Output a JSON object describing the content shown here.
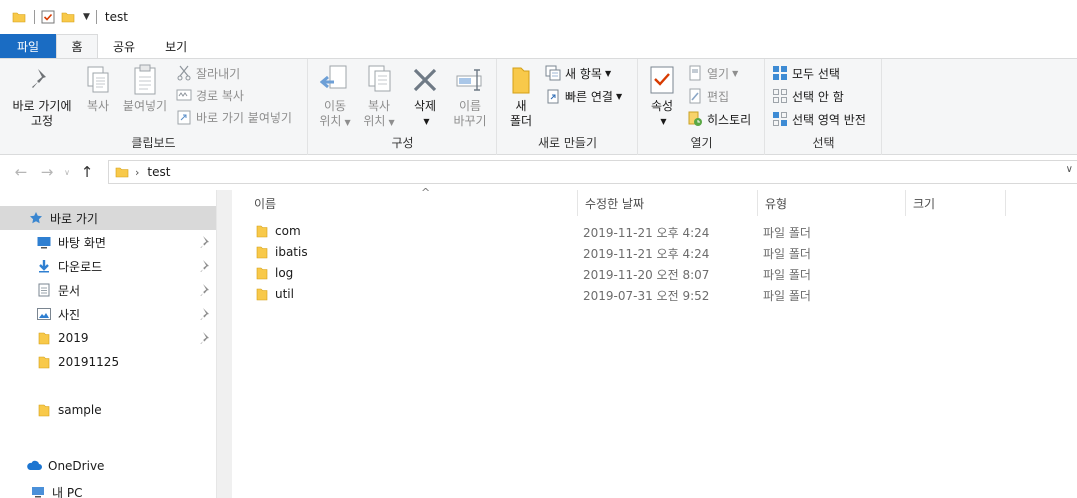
{
  "window": {
    "title": "test"
  },
  "tabs": [
    "파일",
    "홈",
    "공유",
    "보기"
  ],
  "ribbon": {
    "clipboard": {
      "pin_label_1": "바로 가기에",
      "pin_label_2": "고정",
      "copy": "복사",
      "paste": "붙여넣기",
      "cut": "잘라내기",
      "copy_path": "경로 복사",
      "paste_shortcut": "바로 가기 붙여넣기",
      "group": "클립보드"
    },
    "organize": {
      "move_1": "이동",
      "move_2": "위치",
      "copy_1": "복사",
      "copy_2": "위치",
      "delete": "삭제",
      "rename_1": "이름",
      "rename_2": "바꾸기",
      "group": "구성"
    },
    "new": {
      "folder_1": "새",
      "folder_2": "폴더",
      "new_item": "새 항목",
      "easy_access": "빠른 연결",
      "group": "새로 만들기"
    },
    "open": {
      "properties": "속성",
      "open": "열기",
      "edit": "편집",
      "history": "히스토리",
      "group": "열기"
    },
    "select": {
      "select_all": "모두 선택",
      "select_none": "선택 안 함",
      "invert": "선택 영역 반전",
      "group": "선택"
    }
  },
  "address": {
    "crumb": "test"
  },
  "navpane": {
    "quick_access": "바로 가기",
    "items": [
      {
        "label": "바탕 화면",
        "icon": "desktop-icon",
        "pinned": true
      },
      {
        "label": "다운로드",
        "icon": "download-icon",
        "pinned": true
      },
      {
        "label": "문서",
        "icon": "documents-icon",
        "pinned": true
      },
      {
        "label": "사진",
        "icon": "pictures-icon",
        "pinned": true
      },
      {
        "label": "2019",
        "icon": "folder-icon",
        "pinned": true
      },
      {
        "label": "20191125",
        "icon": "folder-icon",
        "pinned": false
      }
    ],
    "sample": "sample",
    "onedrive": "OneDrive",
    "this_pc": "내 PC"
  },
  "filelist": {
    "columns": [
      "이름",
      "수정한 날짜",
      "유형",
      "크기"
    ],
    "rows": [
      {
        "name": "com",
        "modified": "2019-11-21 오후 4:24",
        "type": "파일 폴더"
      },
      {
        "name": "ibatis",
        "modified": "2019-11-21 오후 4:24",
        "type": "파일 폴더"
      },
      {
        "name": "log",
        "modified": "2019-11-20 오전 8:07",
        "type": "파일 폴더"
      },
      {
        "name": "util",
        "modified": "2019-07-31 오전 9:52",
        "type": "파일 폴더"
      }
    ]
  },
  "colors": {
    "accent": "#1a6cc3",
    "folder": "#f8c94a",
    "selected": "#d9d9d9"
  }
}
